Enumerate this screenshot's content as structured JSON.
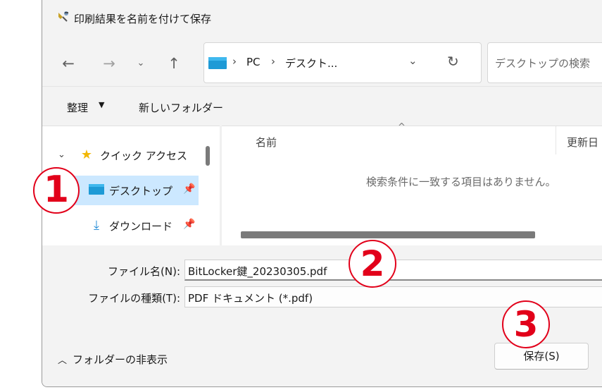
{
  "window": {
    "title": "印刷結果を名前を付けて保存",
    "title_icon": "printer-save-icon"
  },
  "navigation": {
    "back_icon": "arrow-left-icon",
    "forward_icon": "arrow-right-icon",
    "recent_icon": "chevron-down-icon",
    "up_icon": "arrow-up-icon",
    "address": {
      "segments": [
        "PC",
        "デスクト..."
      ],
      "separator": "›"
    },
    "search_placeholder": "デスクトップの検索"
  },
  "commandbar": {
    "organize": "整理",
    "new_folder": "新しいフォルダー"
  },
  "nav_pane": {
    "items": [
      {
        "label": "クイック アクセス",
        "icon": "star-icon",
        "expanded": true
      },
      {
        "label": "デスクトップ",
        "icon": "desktop-folder-icon",
        "pinned": true,
        "selected": true
      },
      {
        "label": "ダウンロード",
        "icon": "download-icon",
        "pinned": true
      }
    ]
  },
  "file_list": {
    "columns": [
      "名前",
      "更新日"
    ],
    "empty_message": "検索条件に一致する項目はありません。"
  },
  "form": {
    "filename_label": "ファイル名(N):",
    "filename_value": "BitLocker鍵_20230305.pdf",
    "filetype_label": "ファイルの種類(T):",
    "filetype_value": "PDF ドキュメント (*.pdf)"
  },
  "footer": {
    "hide_folders": "フォルダーの非表示",
    "save_button": "保存(S)"
  },
  "annotations": [
    "1",
    "2",
    "3"
  ],
  "colors": {
    "accent_selection": "#cce8ff",
    "marker_red": "#e2001a",
    "folder_blue": "#1e9ad6"
  }
}
